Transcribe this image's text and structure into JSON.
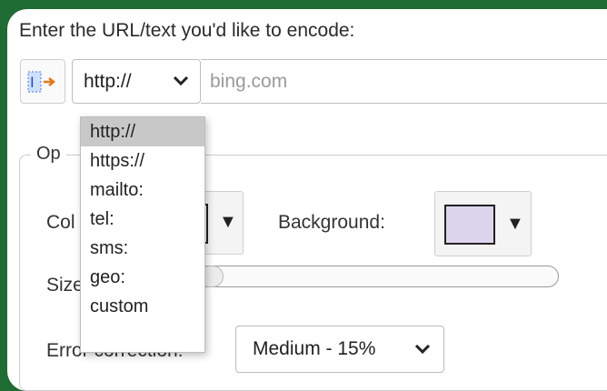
{
  "prompt": "Enter the URL/text you'd like to encode:",
  "input_row": {
    "insert_icon": "insert-text-icon",
    "protocol_value": "http://",
    "url_placeholder": "bing.com"
  },
  "protocol_options": [
    "http://",
    "https://",
    "mailto:",
    "tel:",
    "sms:",
    "geo:",
    "custom"
  ],
  "options": {
    "legend": "Op",
    "color_label": "Col",
    "background_label": "Background:",
    "size_label": "Size",
    "error_label": "Error correction:",
    "error_value": "Medium - 15%",
    "colors": {
      "foreground": "#ffffff",
      "background": "#ddd5ee"
    }
  }
}
